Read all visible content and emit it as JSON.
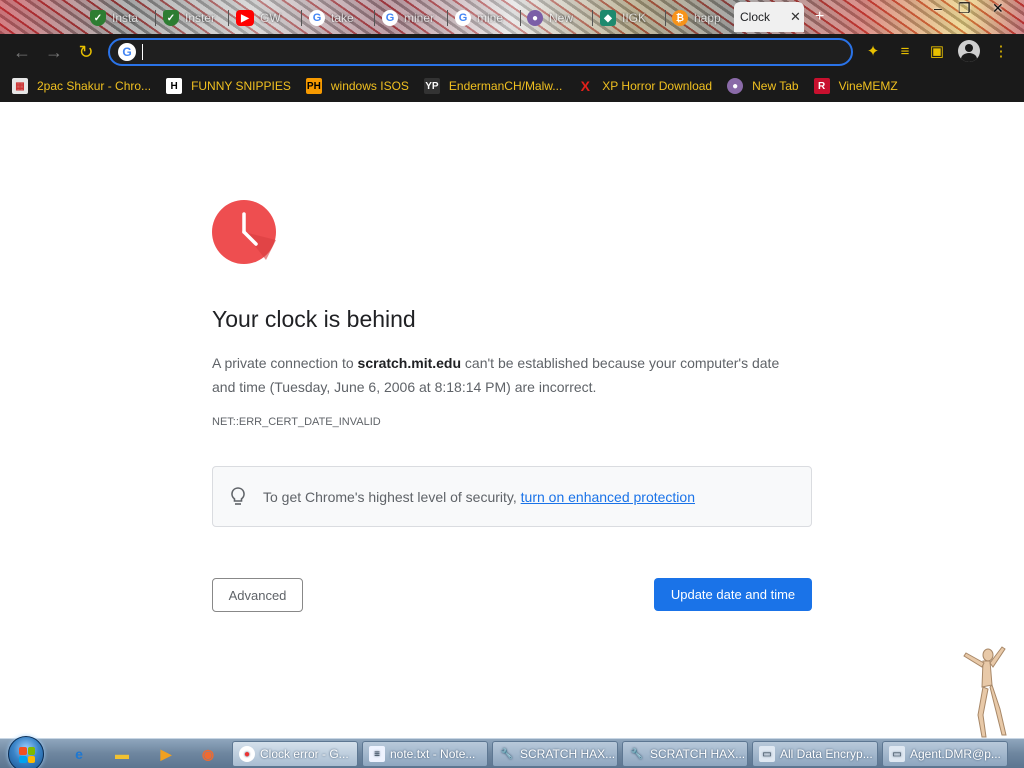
{
  "tabs": [
    {
      "title": "Insta",
      "icon": "shield-check-icon"
    },
    {
      "title": "Inster",
      "icon": "shield-check-icon"
    },
    {
      "title": "GW",
      "icon": "youtube-icon"
    },
    {
      "title": "take",
      "icon": "google-icon"
    },
    {
      "title": "miner",
      "icon": "google-icon"
    },
    {
      "title": "mine",
      "icon": "google-icon"
    },
    {
      "title": "New",
      "icon": "new-tab-icon"
    },
    {
      "title": "IIGK",
      "icon": "app-icon"
    },
    {
      "title": "happ",
      "icon": "bitcoin-icon"
    },
    {
      "title": "Clock",
      "icon": ""
    }
  ],
  "bookmarks": [
    {
      "label": "2pac Shakur - Chro...",
      "icon": "app-grid-icon"
    },
    {
      "label": "FUNNY SNIPPIES",
      "icon": "h-icon"
    },
    {
      "label": "windows ISOS",
      "icon": "ph-icon"
    },
    {
      "label": "EndermanCH/Malw...",
      "icon": "yp-icon"
    },
    {
      "label": "XP Horror Download",
      "icon": "x-icon"
    },
    {
      "label": "New Tab",
      "icon": "globe-icon"
    },
    {
      "label": "VineMEMZ",
      "icon": "r-icon"
    }
  ],
  "page": {
    "heading": "Your clock is behind",
    "desc_before": "A private connection to ",
    "desc_domain": "scratch.mit.edu",
    "desc_after": " can't be established because your computer's date and time (Tuesday, June 6, 2006 at 8:18:14 PM) are incorrect.",
    "error_code": "NET::ERR_CERT_DATE_INVALID",
    "security_text": "To get Chrome's highest level of security, ",
    "security_link": "turn on enhanced protection",
    "advanced_button": "Advanced",
    "update_button": "Update date and time"
  },
  "taskbar": {
    "tasks": [
      {
        "label": "Clock error - G...",
        "icon": "chrome-icon"
      },
      {
        "label": "note.txt - Note...",
        "icon": "notepad-icon"
      },
      {
        "label": "SCRATCH HAX...",
        "icon": "wrench-icon"
      },
      {
        "label": "SCRATCH HAX...",
        "icon": "wrench-icon"
      },
      {
        "label": "All Data Encryp...",
        "icon": "window-icon"
      },
      {
        "label": "Agent.DMR@p...",
        "icon": "window-icon"
      }
    ]
  },
  "colors": {
    "accent": "#1a73e8",
    "clock_red": "#ee4e50",
    "bookmark_text": "#f0c020",
    "toolbar_bg": "#1a1a1a"
  }
}
